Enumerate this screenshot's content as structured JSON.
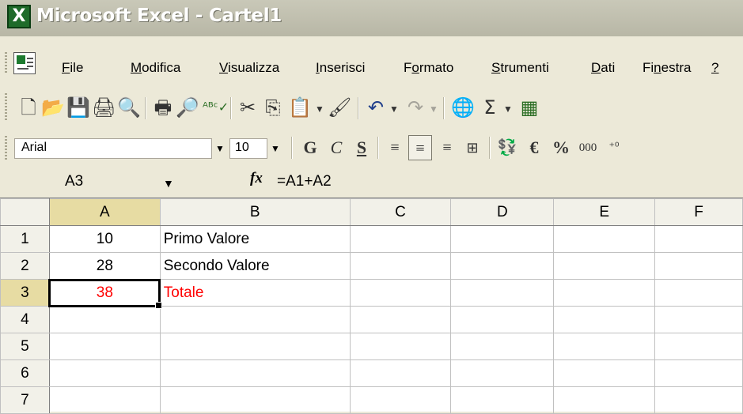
{
  "window": {
    "title": "Microsoft Excel - Cartel1",
    "app_icon": "excel-icon"
  },
  "menu": {
    "items": [
      {
        "pre": "",
        "u": "F",
        "post": "ile"
      },
      {
        "pre": "",
        "u": "M",
        "post": "odifica"
      },
      {
        "pre": "",
        "u": "V",
        "post": "isualizza"
      },
      {
        "pre": "",
        "u": "I",
        "post": "nserisci"
      },
      {
        "pre": "F",
        "u": "o",
        "post": "rmato"
      },
      {
        "pre": "",
        "u": "S",
        "post": "trumenti"
      },
      {
        "pre": "",
        "u": "D",
        "post": "ati"
      },
      {
        "pre": "Fi",
        "u": "n",
        "post": "estra"
      },
      {
        "pre": "",
        "u": "?",
        "post": ""
      }
    ]
  },
  "standard_toolbar": {
    "icons": [
      "new-icon",
      "open-icon",
      "save-icon",
      "permission-icon",
      "research-icon",
      "print-icon",
      "print-preview-icon",
      "spelling-icon",
      "cut-icon",
      "copy-icon",
      "paste-icon",
      "format-painter-icon",
      "undo-icon",
      "redo-icon",
      "hyperlink-icon",
      "autosum-icon",
      "insert-table-icon"
    ],
    "autosum_glyph": "Σ"
  },
  "formatting_toolbar": {
    "font": "Arial",
    "size": "10",
    "bold": "G",
    "italic": "C",
    "underline": "S",
    "currency": "€",
    "percent": "%",
    "thousands": "000"
  },
  "formula_bar": {
    "name_box": "A3",
    "fx": "fx",
    "formula": "=A1+A2"
  },
  "sheet": {
    "columns": [
      "A",
      "B",
      "C",
      "D",
      "E",
      "F"
    ],
    "rows": [
      {
        "n": "1",
        "A": "10",
        "B": "Primo Valore"
      },
      {
        "n": "2",
        "A": "28",
        "B": "Secondo Valore"
      },
      {
        "n": "3",
        "A": "38",
        "B": "Totale"
      },
      {
        "n": "4",
        "A": "",
        "B": ""
      },
      {
        "n": "5",
        "A": "",
        "B": ""
      },
      {
        "n": "6",
        "A": "",
        "B": ""
      },
      {
        "n": "7",
        "A": "",
        "B": ""
      }
    ],
    "active_cell": "A3",
    "highlight_color": "#ff0000"
  }
}
